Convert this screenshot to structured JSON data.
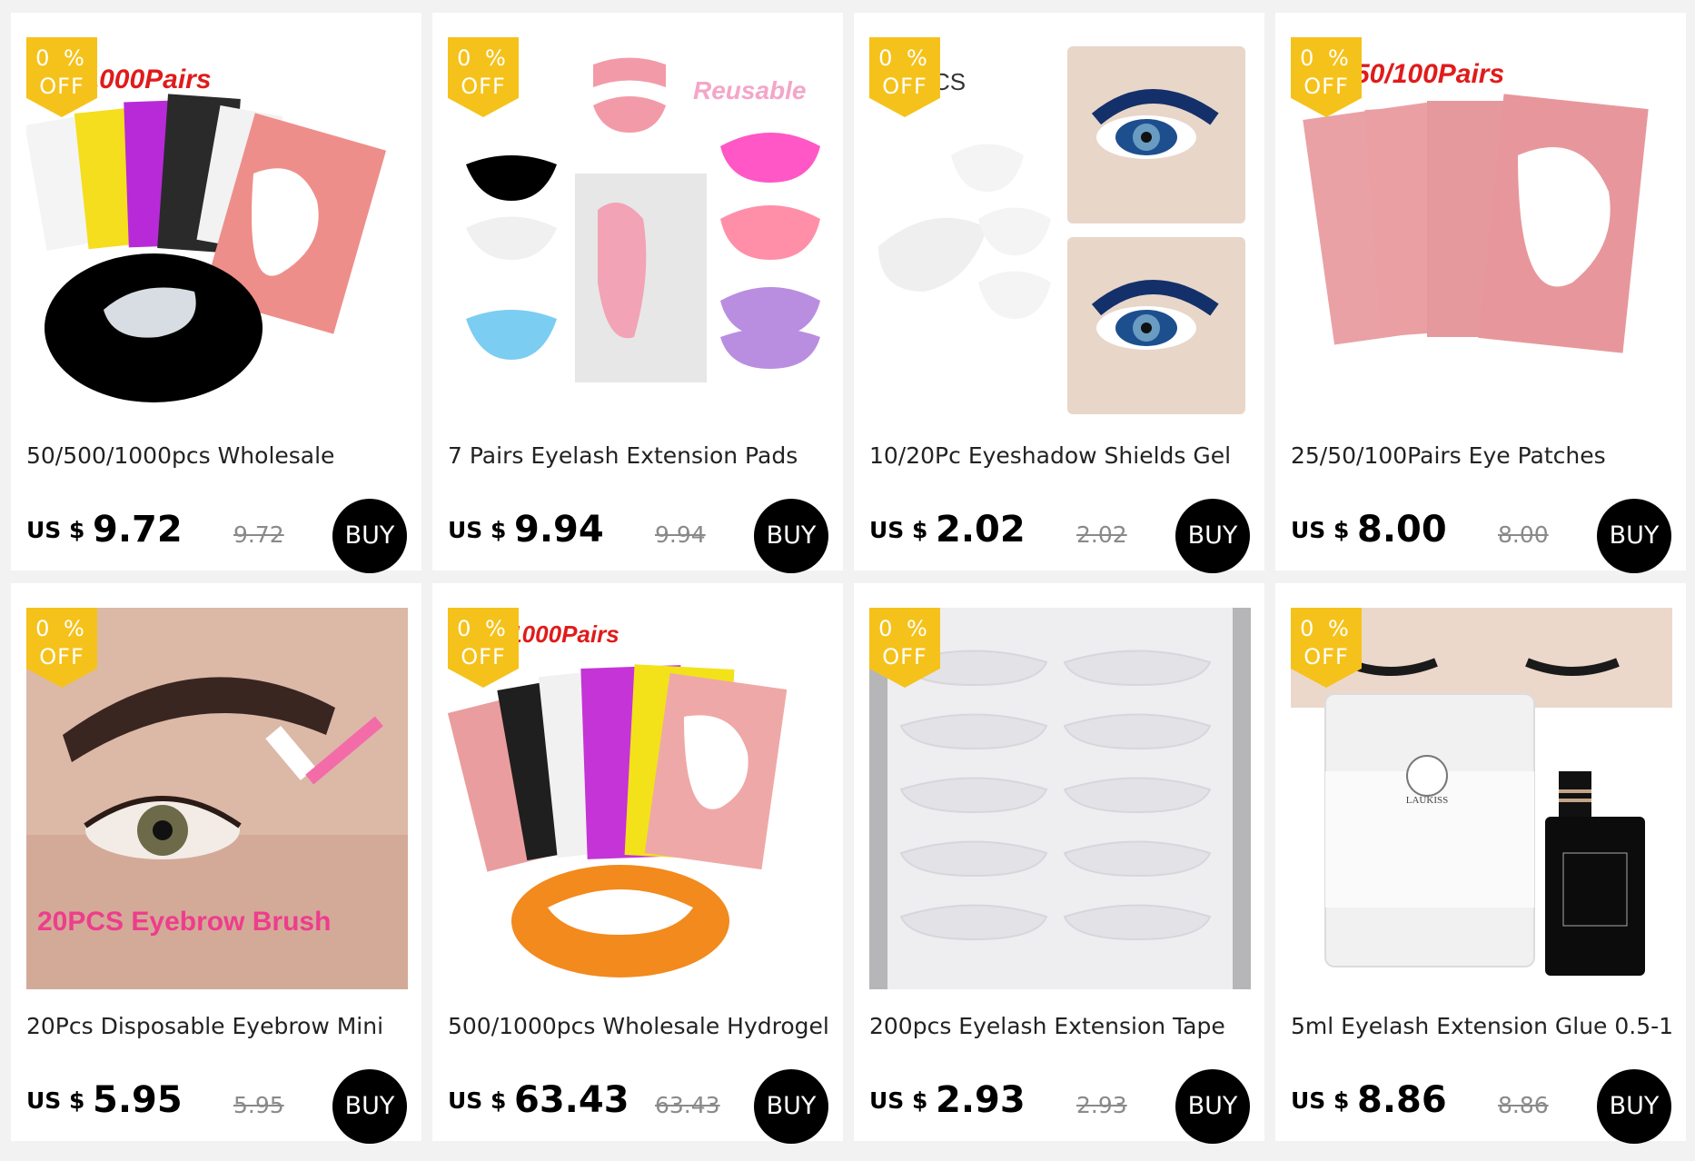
{
  "products": [
    {
      "title": "50/500/1000pcs Wholesale",
      "currency": "US $",
      "price": "9.72",
      "original_price": "9.72",
      "badge_pct": "0 %",
      "badge_off": "OFF",
      "buy_label": "BUY",
      "image_text": "500/1000Pairs"
    },
    {
      "title": "7 Pairs Eyelash Extension Pads",
      "currency": "US $",
      "price": "9.94",
      "original_price": "9.94",
      "badge_pct": "0 %",
      "badge_off": "OFF",
      "buy_label": "BUY",
      "image_text": "Reusable"
    },
    {
      "title": "10/20Pc Eyeshadow Shields Gel",
      "currency": "US $",
      "price": "2.02",
      "original_price": "2.02",
      "badge_pct": "0 %",
      "badge_off": "OFF",
      "buy_label": "BUY",
      "image_text": "CS"
    },
    {
      "title": "25/50/100Pairs Eye Patches",
      "currency": "US $",
      "price": "8.00",
      "original_price": "8.00",
      "badge_pct": "0 %",
      "badge_off": "OFF",
      "buy_label": "BUY",
      "image_text": "50/100Pairs"
    },
    {
      "title": "20Pcs Disposable Eyebrow Mini",
      "currency": "US $",
      "price": "5.95",
      "original_price": "5.95",
      "badge_pct": "0 %",
      "badge_off": "OFF",
      "buy_label": "BUY",
      "image_text": "20PCS Eyebrow Brush"
    },
    {
      "title": "500/1000pcs Wholesale Hydrogel",
      "currency": "US $",
      "price": "63.43",
      "original_price": "63.43",
      "badge_pct": "0 %",
      "badge_off": "OFF",
      "buy_label": "BUY",
      "image_text": "/1000Pairs"
    },
    {
      "title": "200pcs Eyelash Extension Tape",
      "currency": "US $",
      "price": "2.93",
      "original_price": "2.93",
      "badge_pct": "0 %",
      "badge_off": "OFF",
      "buy_label": "BUY",
      "image_text": ""
    },
    {
      "title": "5ml Eyelash Extension Glue 0.5-1",
      "currency": "US $",
      "price": "8.86",
      "original_price": "8.86",
      "badge_pct": "0 %",
      "badge_off": "OFF",
      "buy_label": "BUY",
      "image_text": "LAUKISS"
    }
  ],
  "colors": {
    "badge": "#f5c21b",
    "buy_button": "#000000",
    "background": "#f2f2f2",
    "card": "#ffffff"
  }
}
